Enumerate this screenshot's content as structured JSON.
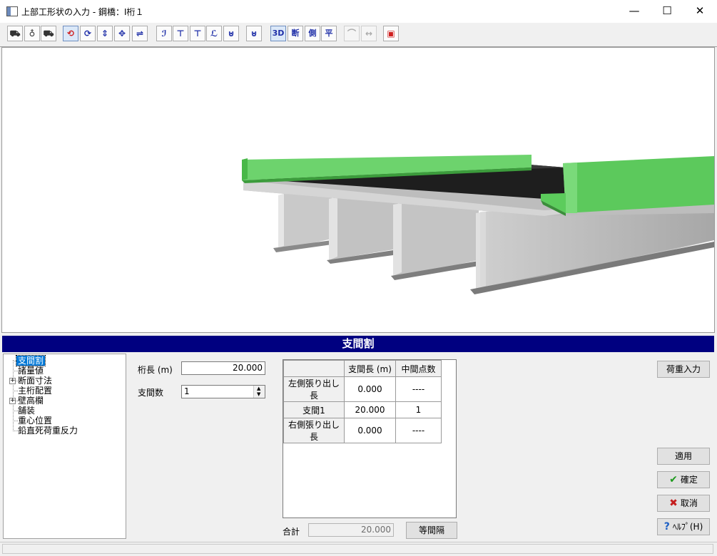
{
  "window": {
    "title": "上部工形状の入力 - 鋼橋：I桁１",
    "minimize_icon": "minimize-icon",
    "maximize_icon": "maximize-icon",
    "close_icon": "close-icon"
  },
  "toolbar": {
    "buttons": [
      {
        "icon": "bridge-view-1-icon",
        "glyph": "⛟"
      },
      {
        "icon": "bridge-view-2-icon",
        "glyph": "♁"
      },
      {
        "icon": "bridge-view-3-icon",
        "glyph": "⛟"
      },
      {
        "icon": "rotate-free-icon",
        "glyph": "⟲"
      },
      {
        "icon": "rotate-horizontal-icon",
        "glyph": "⟳"
      },
      {
        "icon": "rotate-vertical-icon",
        "glyph": "⇕"
      },
      {
        "icon": "pan-icon",
        "glyph": "✥"
      },
      {
        "icon": "zoom-icon",
        "glyph": "⇌"
      },
      {
        "icon": "girder-shape-1-icon",
        "glyph": "ℐ"
      },
      {
        "icon": "girder-shape-2-icon",
        "glyph": "⊤"
      },
      {
        "icon": "girder-shape-3-icon",
        "glyph": "⊤"
      },
      {
        "icon": "girder-shape-4-icon",
        "glyph": "ℒ"
      },
      {
        "icon": "girder-shape-5-icon",
        "glyph": "⊍"
      },
      {
        "icon": "cross-section-icon",
        "glyph": "⊍"
      },
      {
        "label": "3D",
        "icon": "view-3d-button"
      },
      {
        "label": "断",
        "icon": "view-section-button"
      },
      {
        "label": "側",
        "icon": "view-side-button"
      },
      {
        "label": "平",
        "icon": "view-plan-button"
      },
      {
        "icon": "dimension-toggle-icon",
        "glyph": "⌒"
      },
      {
        "icon": "dimension-scale-icon",
        "glyph": "↔"
      },
      {
        "icon": "export-image-icon",
        "glyph": "▣"
      }
    ]
  },
  "panel": {
    "title": "支間割"
  },
  "tree": {
    "items": [
      {
        "label": "支間割",
        "selected": true,
        "expandable": false
      },
      {
        "label": "諸量値",
        "selected": false,
        "expandable": false
      },
      {
        "label": "断面寸法",
        "selected": false,
        "expandable": true
      },
      {
        "label": "主桁配置",
        "selected": false,
        "expandable": false
      },
      {
        "label": "壁高欄",
        "selected": false,
        "expandable": true
      },
      {
        "label": "舗装",
        "selected": false,
        "expandable": false
      },
      {
        "label": "重心位置",
        "selected": false,
        "expandable": false
      },
      {
        "label": "鉛直死荷重反力",
        "selected": false,
        "expandable": false
      }
    ]
  },
  "form": {
    "girder_length_label": "桁長 (m)",
    "girder_length_value": "20.000",
    "span_count_label": "支間数",
    "span_count_value": "1"
  },
  "grid": {
    "headers": [
      "",
      "支間長 (m)",
      "中間点数"
    ],
    "rows": [
      {
        "name": "左側張り出し長",
        "length": "0.000",
        "points": "----"
      },
      {
        "name": "支間1",
        "length": "20.000",
        "points": "1"
      },
      {
        "name": "右側張り出し長",
        "length": "0.000",
        "points": "----"
      }
    ]
  },
  "total": {
    "label": "合計",
    "value": "20.000",
    "equal_spacing_button": "等間隔"
  },
  "buttons": {
    "load_input": "荷重入力",
    "apply": "適用",
    "ok": "確定",
    "cancel": "取消",
    "help": "ﾍﾙﾌﾟ(H)"
  },
  "colors": {
    "panel_title_bg": "#000080",
    "barrier_green": "#5ccc5c",
    "girder_grey": "#c8c8c8",
    "pavement_black": "#1e1e1e"
  }
}
